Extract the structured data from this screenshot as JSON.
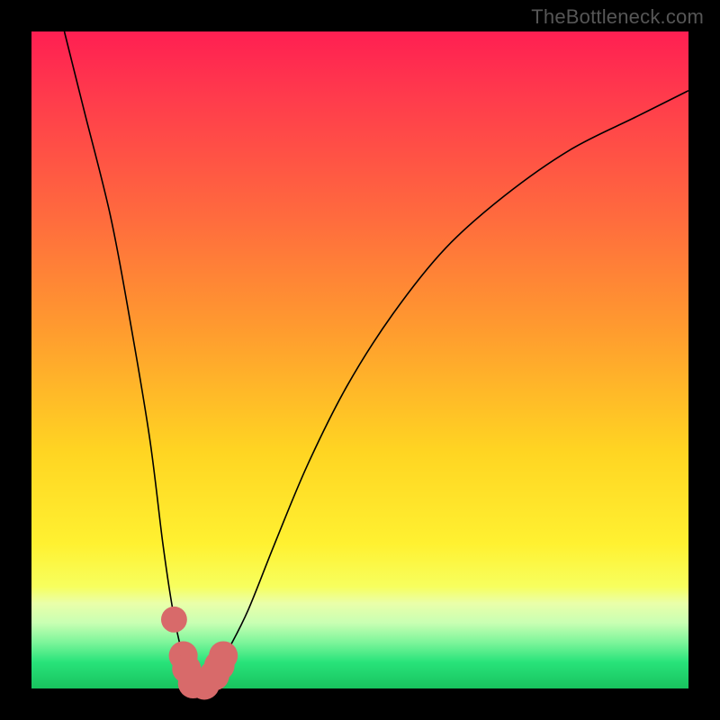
{
  "watermark": "TheBottleneck.com",
  "chart_data": {
    "type": "line",
    "title": "",
    "xlabel": "",
    "ylabel": "",
    "xlim": [
      0,
      100
    ],
    "ylim": [
      0,
      100
    ],
    "series": [
      {
        "name": "bottleneck-curve",
        "x": [
          5,
          8,
          12,
          15,
          18,
          20,
          21.5,
          23,
          24,
          25,
          26,
          27,
          28,
          30,
          33,
          37,
          42,
          48,
          55,
          63,
          72,
          82,
          92,
          100
        ],
        "y": [
          100,
          88,
          72,
          56,
          38,
          22,
          12,
          5,
          2,
          0,
          0,
          1,
          2.5,
          6,
          12,
          22,
          34,
          46,
          57,
          67,
          75,
          82,
          87,
          91
        ]
      }
    ],
    "markers": {
      "name": "highlight-dots",
      "points": [
        {
          "x": 21.7,
          "y": 10.5,
          "r": 1.3
        },
        {
          "x": 23.1,
          "y": 5.0,
          "r": 1.5
        },
        {
          "x": 23.6,
          "y": 3.0,
          "r": 1.5
        },
        {
          "x": 24.6,
          "y": 0.8,
          "r": 1.6
        },
        {
          "x": 26.3,
          "y": 0.6,
          "r": 1.6
        },
        {
          "x": 27.8,
          "y": 2.0,
          "r": 1.6
        },
        {
          "x": 28.6,
          "y": 3.5,
          "r": 1.6
        },
        {
          "x": 29.2,
          "y": 5.0,
          "r": 1.5
        }
      ]
    },
    "gradient_stops": [
      {
        "pos": 0,
        "color": "#ff1f52"
      },
      {
        "pos": 45,
        "color": "#ff9a2f"
      },
      {
        "pos": 78,
        "color": "#fff131"
      },
      {
        "pos": 100,
        "color": "#18c35e"
      }
    ]
  }
}
